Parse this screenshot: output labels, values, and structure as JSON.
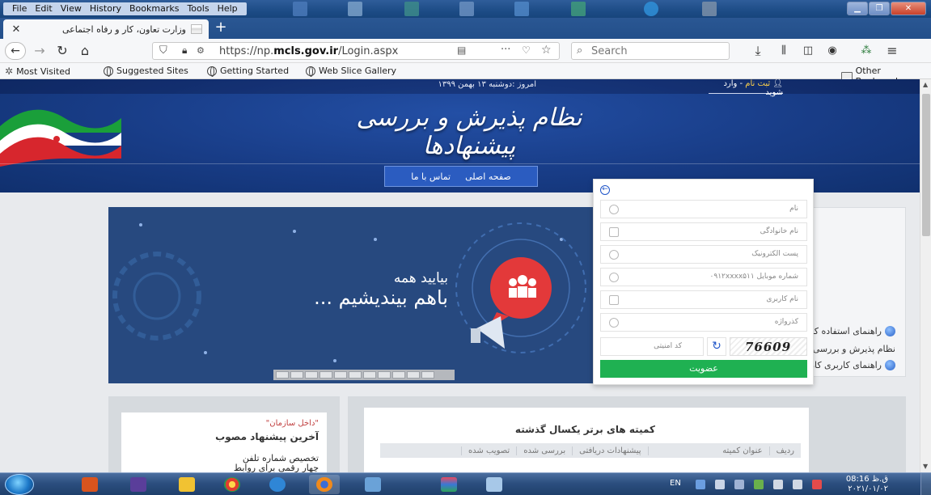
{
  "browser": {
    "menu": [
      "File",
      "Edit",
      "View",
      "History",
      "Bookmarks",
      "Tools",
      "Help"
    ],
    "tab_title": "وزارت تعاون، کار و رفاه اجتماعی",
    "tab_close": "✕",
    "new_tab": "+",
    "url_prefix": "https://np.",
    "url_domain": "mcls.gov.ir",
    "url_path": "/Login.aspx",
    "search_placeholder": "Search",
    "bookmarks": [
      "Most Visited",
      "Suggested Sites",
      "Getting Started",
      "Web Slice Gallery"
    ],
    "other_bookmarks": "Other Bookmarks"
  },
  "header": {
    "date": "امروز :دوشنبه ۱۳ بهمن ۱۳۹۹",
    "register": "ثبت نام",
    "register_sep": " - ",
    "login": "وارد شوید",
    "title": "نظام پذیرش و بررسی پیشنهادها",
    "nav": [
      "صفحه اصلی",
      "تماس با ما"
    ]
  },
  "banner": {
    "line1": "بیایید همه",
    "line2": "باهم بیندیشیم ..."
  },
  "side_panel": {
    "links": [
      "راهنمای استفاده کاربران سامانه",
      "نظام پذیرش و بررسی پیشنهادها",
      "راهنمای کاربری کارتابل کمیته"
    ]
  },
  "news": {
    "tag": "\"داخل سازمان\"",
    "title": "آخرین پیشنهاد مصوب",
    "item": "تخصیص شماره تلفن چهار رقمی برای روابط کار"
  },
  "committee": {
    "title": "کمیته های برتر یکسال گذشته",
    "columns": [
      "ردیف",
      "عنوان کمیته",
      "پیشنهادات دریافتی",
      "بررسی شده",
      "تصویب شده"
    ]
  },
  "login": {
    "fields": [
      {
        "placeholder": "نام",
        "icon": "user-icon"
      },
      {
        "placeholder": "نام خانوادگی",
        "icon": "id-card-icon"
      },
      {
        "placeholder": "پست الکترونیک",
        "icon": "at-icon"
      },
      {
        "placeholder": "شماره موبایل ۰۹۱۲xxxx۵۱۱",
        "icon": "mobile-icon"
      },
      {
        "placeholder": "نام کاربری",
        "icon": "user-card-icon"
      },
      {
        "placeholder": "کذرواژه",
        "icon": "eye-slash-icon"
      }
    ],
    "captcha_placeholder": "کد امنیتی",
    "captcha_code": "76609",
    "submit": "عضویت"
  },
  "taskbar": {
    "lang": "EN",
    "time": "08:16 ق.ظ",
    "date": "۲۰۲۱/۰۱/۰۲"
  },
  "colors": {
    "header_blue": "#183c86",
    "submit_green": "#1fb152",
    "link_blue": "#1f55c8"
  }
}
